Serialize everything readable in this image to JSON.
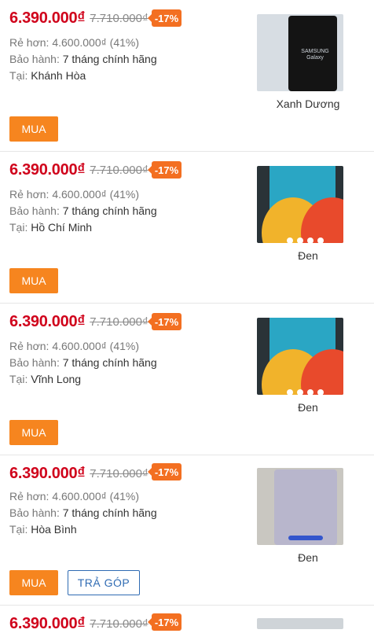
{
  "listings": [
    {
      "price": "6.390.000₫",
      "old_price": "7.710.000₫",
      "discount": "-17%",
      "savings_label": "Rẻ hơn:",
      "savings_value": "4.600.000₫ (41%)",
      "warranty_label": "Bảo hành:",
      "warranty_value": "7 tháng chính hãng",
      "location_label": "Tại:",
      "location_value": "Khánh Hòa",
      "color": "Xanh Dương",
      "thumb_text": "SAMSUNG Galaxy",
      "buy_label": "MUA"
    },
    {
      "price": "6.390.000₫",
      "old_price": "7.710.000₫",
      "discount": "-17%",
      "savings_label": "Rẻ hơn:",
      "savings_value": "4.600.000₫ (41%)",
      "warranty_label": "Bảo hành:",
      "warranty_value": "7 tháng chính hãng",
      "location_label": "Tại:",
      "location_value": "Hồ Chí Minh",
      "color": "Đen",
      "buy_label": "MUA"
    },
    {
      "price": "6.390.000₫",
      "old_price": "7.710.000₫",
      "discount": "-17%",
      "savings_label": "Rẻ hơn:",
      "savings_value": "4.600.000₫ (41%)",
      "warranty_label": "Bảo hành:",
      "warranty_value": "7 tháng chính hãng",
      "location_label": "Tại:",
      "location_value": "Vĩnh Long",
      "color": "Đen",
      "buy_label": "MUA"
    },
    {
      "price": "6.390.000₫",
      "old_price": "7.710.000₫",
      "discount": "-17%",
      "savings_label": "Rẻ hơn:",
      "savings_value": "4.600.000₫ (41%)",
      "warranty_label": "Bảo hành:",
      "warranty_value": "7 tháng chính hãng",
      "location_label": "Tại:",
      "location_value": "Hòa Bình",
      "color": "Đen",
      "buy_label": "MUA",
      "installment_label": "TRẢ GÓP"
    },
    {
      "price": "6.390.000₫",
      "old_price": "7.710.000₫",
      "discount": "-17%"
    }
  ],
  "colors": {
    "price": "#d0021b",
    "badge": "#f36f21",
    "buy_button": "#f6851f",
    "installment_border": "#2f6bb3"
  }
}
